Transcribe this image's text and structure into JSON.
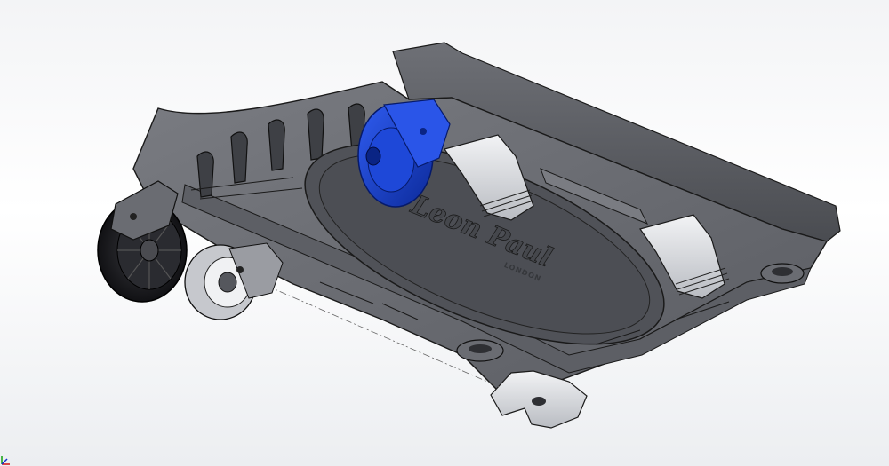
{
  "viewport": {
    "background_top": "#f3f4f6",
    "background_bottom": "#eceef1"
  },
  "model": {
    "logo_text": "Leon Paul",
    "logo_subtext": "LONDON",
    "body_color": "#55575d",
    "edge_color": "#1a1a1a",
    "highlight_color": "#d9dbe0",
    "caster_color": "#1538b8",
    "wheel_color": "#1f1f22"
  },
  "triad": {
    "x_axis_color": "#d01010",
    "y_axis_color": "#10a010",
    "z_axis_color": "#1030d0"
  }
}
